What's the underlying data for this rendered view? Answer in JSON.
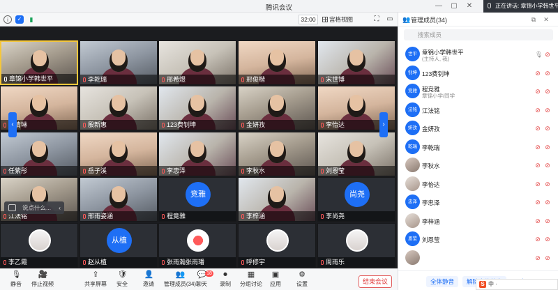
{
  "window": {
    "title": "腾讯会议",
    "speaking": "正在讲话: 章锦小学韩世平"
  },
  "infobar": {
    "time": "32:00",
    "view_label": "宫格视图"
  },
  "grid": {
    "tiles": [
      {
        "name": "章锦小学韩世平",
        "kind": "photo",
        "bg": "bg-a",
        "active": true,
        "host": true
      },
      {
        "name": "李乾瑞",
        "kind": "photo",
        "bg": "bg-d"
      },
      {
        "name": "邢希煜",
        "kind": "photo",
        "bg": "bg-b"
      },
      {
        "name": "邢俊楷",
        "kind": "photo",
        "bg": "bg-c"
      },
      {
        "name": "宋世博",
        "kind": "photo",
        "bg": "bg-e"
      },
      {
        "name": "杨清琳",
        "kind": "photo",
        "bg": "bg-c"
      },
      {
        "name": "殷新惠",
        "kind": "photo",
        "bg": "bg-b"
      },
      {
        "name": "123费钊坤",
        "kind": "photo",
        "bg": "bg-e"
      },
      {
        "name": "金妍孜",
        "kind": "photo",
        "bg": "bg-a"
      },
      {
        "name": "李怡达",
        "kind": "photo",
        "bg": "bg-c"
      },
      {
        "name": "任紫彤",
        "kind": "photo",
        "bg": "bg-d"
      },
      {
        "name": "岳子溪",
        "kind": "photo",
        "bg": "bg-c"
      },
      {
        "name": "李忠泽",
        "kind": "photo",
        "bg": "bg-e"
      },
      {
        "name": "李秋水",
        "kind": "photo",
        "bg": "bg-a"
      },
      {
        "name": "刘恩莹",
        "kind": "photo",
        "bg": "bg-b"
      },
      {
        "name": "江法铭",
        "kind": "photo",
        "bg": "bg-a"
      },
      {
        "name": "邢雨姿涵",
        "kind": "photo",
        "bg": "bg-d"
      },
      {
        "name": "程竟雅",
        "kind": "avatar",
        "avatar": "竞雅"
      },
      {
        "name": "李梓涵",
        "kind": "photo",
        "bg": "bg-e"
      },
      {
        "name": "李尚尧",
        "kind": "avatar",
        "avatar": "尚尧"
      },
      {
        "name": "李乙霞",
        "kind": "small-photo"
      },
      {
        "name": "赵从植",
        "kind": "avatar",
        "avatar": "从植"
      },
      {
        "name": "张雨瀚张雨璠",
        "kind": "small-red"
      },
      {
        "name": "呼修宇",
        "kind": "small-photo"
      },
      {
        "name": "周雨乐",
        "kind": "small-photo"
      }
    ],
    "chat_placeholder": "说点什么...",
    "chat_arrow": "‹"
  },
  "toolbar": {
    "items": [
      {
        "label": "静音",
        "icon": "🎙",
        "name": "mute"
      },
      {
        "label": "停止视频",
        "icon": "🎥",
        "name": "stop-video"
      },
      {
        "label": "共享屏幕",
        "icon": "⇪",
        "name": "share-screen"
      },
      {
        "label": "安全",
        "icon": "🛡",
        "name": "security"
      },
      {
        "label": "邀请",
        "icon": "👤",
        "name": "invite"
      },
      {
        "label": "管理成员(34)",
        "icon": "👥",
        "name": "manage-members"
      },
      {
        "label": "聊天",
        "icon": "💬",
        "name": "chat",
        "badge": "18"
      },
      {
        "label": "录制",
        "icon": "⏺",
        "name": "record"
      },
      {
        "label": "分组讨论",
        "icon": "▦",
        "name": "breakout"
      },
      {
        "label": "应用",
        "icon": "▣",
        "name": "apps"
      },
      {
        "label": "设置",
        "icon": "⚙",
        "name": "settings"
      }
    ],
    "end_label": "结束会议"
  },
  "panel": {
    "title": "管理成员(34)",
    "search_placeholder": "搜索成员",
    "members": [
      {
        "avatar": "世平",
        "name": "章锦小学韩世平",
        "sub": "(主持人, 我)",
        "mic_on": true,
        "cam": false
      },
      {
        "avatar": "钊坤",
        "name": "123费钊坤"
      },
      {
        "avatar": "竞雅",
        "name": "程竞雅",
        "sub": "章锦小学/同学"
      },
      {
        "avatar": "法铭",
        "name": "江法铭"
      },
      {
        "avatar": "妍孜",
        "name": "金妍孜"
      },
      {
        "avatar": "乾瑞",
        "name": "李乾瑞"
      },
      {
        "avatar": "",
        "name": "李秋水",
        "photo": true
      },
      {
        "avatar": "",
        "name": "李怡达",
        "photo": "2"
      },
      {
        "avatar": "忠泽",
        "name": "李忠泽"
      },
      {
        "avatar": "",
        "name": "李梓涵",
        "photo": "2"
      },
      {
        "avatar": "恩莹",
        "name": "刘恩莹"
      },
      {
        "avatar": "",
        "name": "",
        "photo": true
      }
    ],
    "footer": {
      "mute_all": "全体静音",
      "unmute_all": "解除全体静音",
      "more": "更多"
    }
  },
  "ime": {
    "label": "中 ·"
  }
}
